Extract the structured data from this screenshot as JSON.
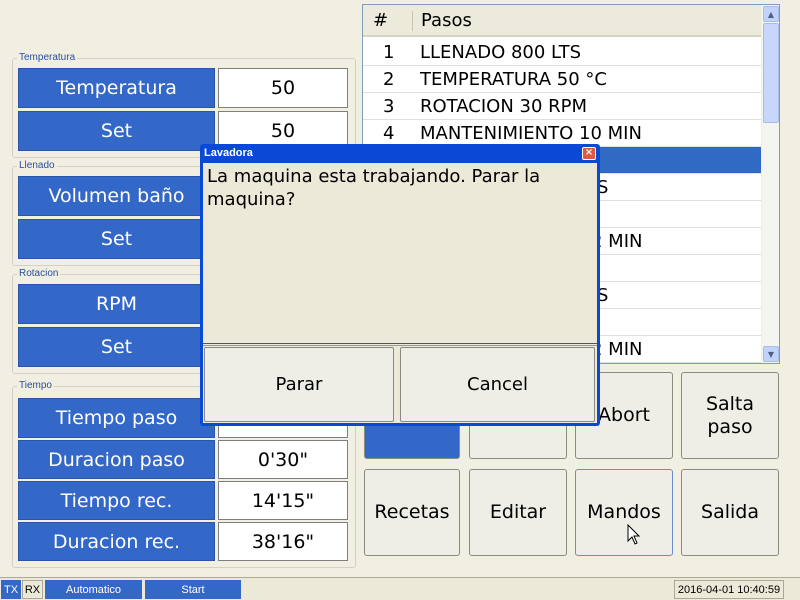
{
  "groups": {
    "temperatura": {
      "title": "Temperatura",
      "rows": [
        {
          "label": "Temperatura",
          "value": "50"
        },
        {
          "label": "Set",
          "value": "50"
        }
      ]
    },
    "llenado": {
      "title": "Llenado",
      "rows": [
        {
          "label": "Volumen baño",
          "value": ""
        },
        {
          "label": "Set",
          "value": ""
        }
      ]
    },
    "rotacion": {
      "title": "Rotacion",
      "rows": [
        {
          "label": "RPM",
          "value": ""
        },
        {
          "label": "Set",
          "value": ""
        }
      ]
    },
    "tiempo": {
      "title": "Tiempo",
      "rows": [
        {
          "label": "Tiempo paso",
          "value": ""
        },
        {
          "label": "Duracion paso",
          "value": "0'30\""
        },
        {
          "label": "Tiempo rec.",
          "value": "14'15\""
        },
        {
          "label": "Duracion rec.",
          "value": "38'16\""
        }
      ]
    }
  },
  "table": {
    "headers": [
      "#",
      "Pasos"
    ],
    "rows": [
      {
        "num": "1",
        "text": "LLENADO 800 LTS"
      },
      {
        "num": "2",
        "text": "TEMPERATURA 50 °C"
      },
      {
        "num": "3",
        "text": "ROTACION 30 RPM"
      },
      {
        "num": "4",
        "text": "MANTENIMIENTO 10 MIN"
      },
      {
        "num": "",
        "text": ""
      },
      {
        "num": "",
        "text": "S"
      },
      {
        "num": "",
        "text": ""
      },
      {
        "num": "",
        "text": "2 MIN"
      },
      {
        "num": "",
        "text": ""
      },
      {
        "num": "",
        "text": "S"
      },
      {
        "num": "",
        "text": ""
      },
      {
        "num": "",
        "text": "2 MIN"
      }
    ]
  },
  "buttons": {
    "abort": "Abort",
    "salta_paso_1": "Salta",
    "salta_paso_2": "paso",
    "recetas": "Recetas",
    "editar": "Editar",
    "mandos": "Mandos",
    "salida": "Salida"
  },
  "dialog": {
    "title": "Lavadora",
    "message": "La maquina esta trabajando. Parar la maquina?",
    "ok_label": "Parar",
    "cancel_label": "Cancel",
    "close_glyph": "×"
  },
  "statusbar": {
    "tx": "TX",
    "rx": "RX",
    "mode": "Automatico",
    "start": "Start",
    "datetime": "2016-04-01 10:40:59"
  },
  "colors": {
    "label_bg": "#3468c8",
    "selection": "#316ac5",
    "titlebar": "#0a49d6",
    "window_bg": "#f1efe2"
  }
}
